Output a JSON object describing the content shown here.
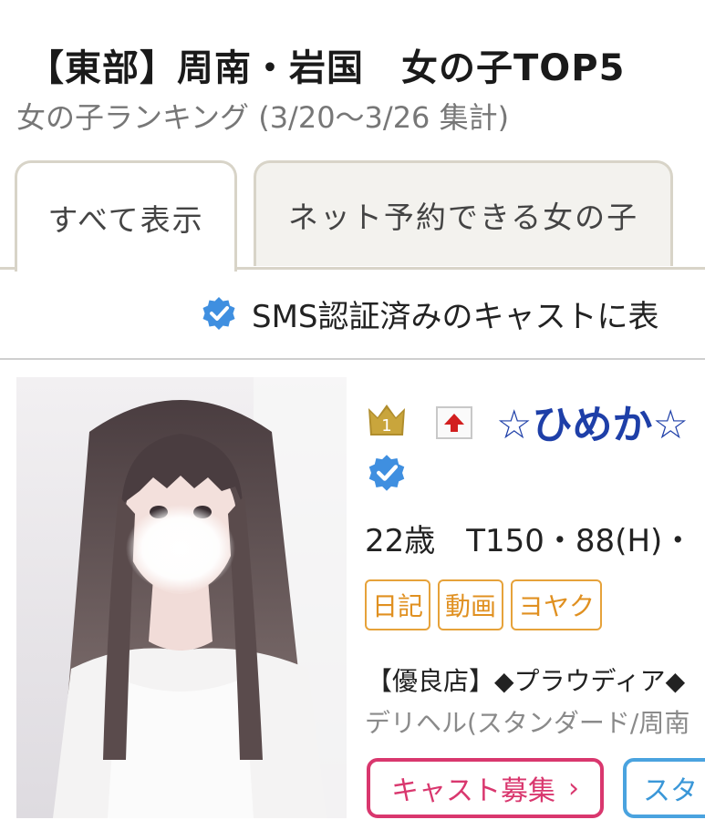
{
  "header": {
    "title": "【東部】周南・岩国　女の子TOP5",
    "subtitle": "女の子ランキング (3/20〜3/26 集計)"
  },
  "tabs": [
    {
      "label": "すべて表示",
      "active": true
    },
    {
      "label": "ネット予約できる女の子",
      "active": false
    }
  ],
  "sms_notice": "SMS認証済みのキャストに表",
  "cast": {
    "rank": "1",
    "name": "☆ひめか☆",
    "stats": "22歳　T150・88(H)・",
    "tags": [
      "日記",
      "動画",
      "ヨヤク"
    ],
    "shop": "【優良店】◆プラウディア◆",
    "category": "デリヘル(スタンダード/周南",
    "recruit_button": "キャスト募集",
    "recruit_chevron": "›",
    "staff_button": "スタ"
  },
  "colors": {
    "name": "#1e3fa8",
    "tag": "#e09020",
    "recruit": "#d9376e",
    "staff": "#3a97d8",
    "verify": "#3f8fe0",
    "rank_up": "#d21f1f"
  },
  "icons": {
    "verify": "verified-check-icon",
    "rank": "crown-icon",
    "rank_change": "rank-up-arrow-icon"
  }
}
